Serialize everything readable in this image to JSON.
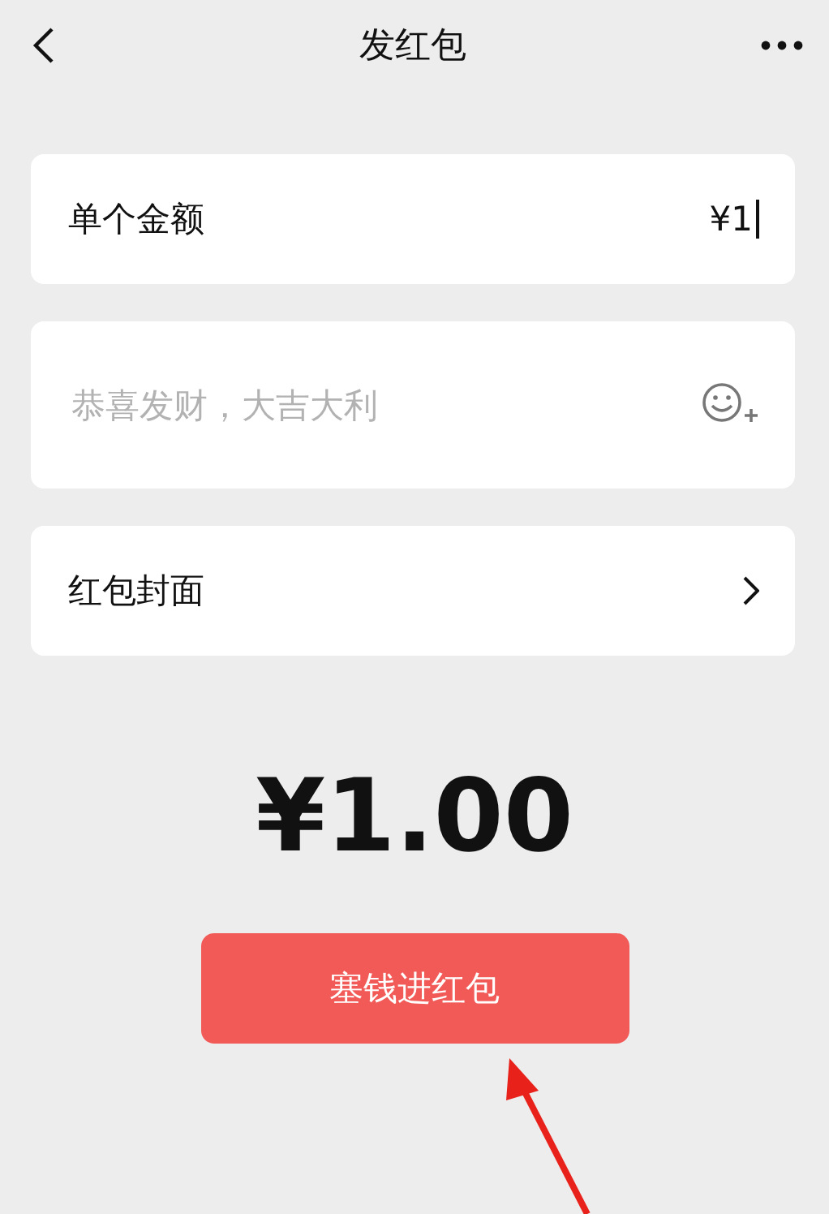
{
  "header": {
    "title": "发红包"
  },
  "amount_row": {
    "label": "单个金额",
    "value": "¥1"
  },
  "message": {
    "placeholder": "恭喜发财，大吉大利"
  },
  "cover_row": {
    "label": "红包封面"
  },
  "total": "¥1.00",
  "submit_button": "塞钱进红包"
}
